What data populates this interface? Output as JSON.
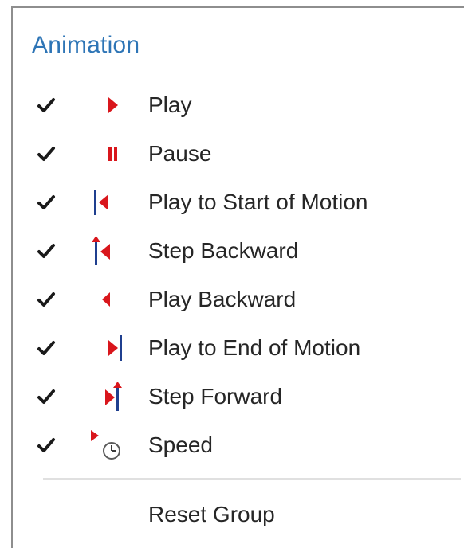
{
  "menu": {
    "heading": "Animation",
    "items": [
      {
        "label": "Play",
        "icon": "play-icon",
        "checked": true
      },
      {
        "label": "Pause",
        "icon": "pause-icon",
        "checked": true
      },
      {
        "label": "Play to Start of Motion",
        "icon": "play-to-start-icon",
        "checked": true
      },
      {
        "label": "Step Backward",
        "icon": "step-backward-icon",
        "checked": true
      },
      {
        "label": "Play Backward",
        "icon": "play-backward-icon",
        "checked": true
      },
      {
        "label": "Play to End of Motion",
        "icon": "play-to-end-icon",
        "checked": true
      },
      {
        "label": "Step Forward",
        "icon": "step-forward-icon",
        "checked": true
      },
      {
        "label": "Speed",
        "icon": "speed-icon",
        "checked": true
      }
    ],
    "reset_label": "Reset Group"
  },
  "colors": {
    "heading": "#2e75b6",
    "icon_red": "#d9161c",
    "icon_blue": "#1f3f8f",
    "text": "#262626"
  }
}
